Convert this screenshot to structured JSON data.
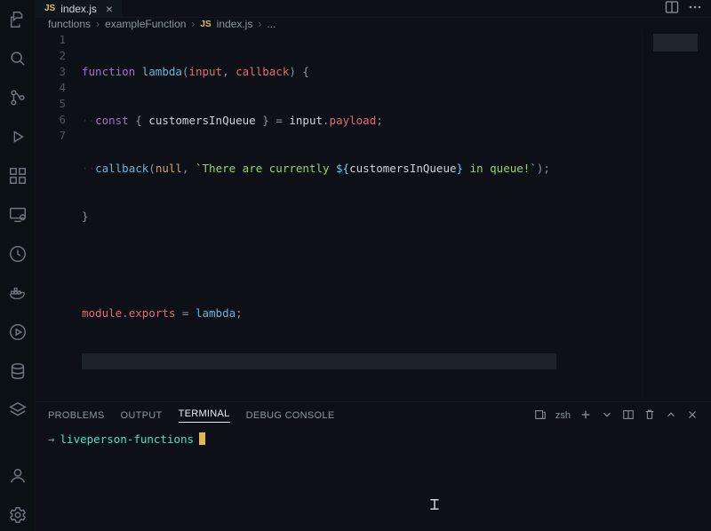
{
  "tab": {
    "icon_label": "JS",
    "filename": "index.js"
  },
  "breadcrumbs": {
    "seg1": "functions",
    "seg2": "exampleFunction",
    "icon_label": "JS",
    "seg3": "index.js",
    "seg4": "..."
  },
  "editor": {
    "line_numbers": [
      "1",
      "2",
      "3",
      "4",
      "5",
      "6",
      "7"
    ],
    "lines": {
      "l1": {
        "kw1": "function",
        "fn": "lambda",
        "p1": "(",
        "a1": "input",
        "c1": ", ",
        "a2": "callback",
        "p2": ")",
        "sp": " ",
        "br": "{"
      },
      "l2": {
        "ws": "··",
        "kw": "const",
        "sp1": " ",
        "br1": "{",
        "sp2": " ",
        "id": "customersInQueue",
        "sp3": " ",
        "br2": "}",
        "sp4": " ",
        "eq": "=",
        "sp5": " ",
        "obj": "input",
        "dot": ".",
        "prop": "payload",
        "semi": ";"
      },
      "l3": {
        "ws": "··",
        "fn": "callback",
        "p1": "(",
        "n": "null",
        "c": ",",
        "sp": " ",
        "bt1": "`",
        "s1": "There are currently ",
        "tp1": "${",
        "id": "customersInQueue",
        "tp2": "}",
        "s2": " in queue!",
        "bt2": "`",
        "p2": ")",
        "semi": ";"
      },
      "l4": {
        "br": "}"
      },
      "l6": {
        "m1": "module",
        "d1": ".",
        "p1": "exports",
        "sp1": " ",
        "eq": "=",
        "sp2": " ",
        "fn": "lambda",
        "semi": ";"
      }
    }
  },
  "panel": {
    "tabs": {
      "problems": "PROBLEMS",
      "output": "OUTPUT",
      "terminal": "TERMINAL",
      "debug": "DEBUG CONSOLE"
    },
    "shell": "zsh",
    "prompt_arrow": "→",
    "prompt_cwd": "liveperson-functions"
  }
}
